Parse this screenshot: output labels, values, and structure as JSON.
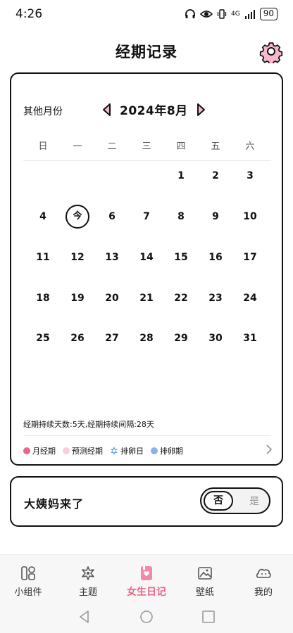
{
  "status_bar": {
    "time": "4:26",
    "network": "4G",
    "battery": "90"
  },
  "header": {
    "title": "经期记录"
  },
  "calendar": {
    "other_months_label": "其他月份",
    "month_label": "2024年8月",
    "weekdays": [
      "日",
      "一",
      "二",
      "三",
      "四",
      "五",
      "六"
    ],
    "days": [
      {
        "label": "1"
      },
      {
        "label": "2"
      },
      {
        "label": "3"
      },
      {
        "label": "4"
      },
      {
        "label": "今",
        "today": true
      },
      {
        "label": "6"
      },
      {
        "label": "7"
      },
      {
        "label": "8"
      },
      {
        "label": "9"
      },
      {
        "label": "10"
      },
      {
        "label": "11"
      },
      {
        "label": "12"
      },
      {
        "label": "13"
      },
      {
        "label": "14"
      },
      {
        "label": "15"
      },
      {
        "label": "16"
      },
      {
        "label": "17"
      },
      {
        "label": "18"
      },
      {
        "label": "19"
      },
      {
        "label": "20"
      },
      {
        "label": "21"
      },
      {
        "label": "22"
      },
      {
        "label": "23"
      },
      {
        "label": "24"
      },
      {
        "label": "25"
      },
      {
        "label": "26"
      },
      {
        "label": "27"
      },
      {
        "label": "28"
      },
      {
        "label": "29"
      },
      {
        "label": "30"
      },
      {
        "label": "31"
      }
    ],
    "first_weekday": 4,
    "stats": "经期持续天数:5天,经期持续间隔:28天",
    "legend": [
      {
        "label": "月经期",
        "color": "#e9658a",
        "icon": "dot"
      },
      {
        "label": "预测经期",
        "color": "#f8cfdc",
        "icon": "dot"
      },
      {
        "label": "排卵日",
        "color": "#6ea8e6",
        "icon": "flower"
      },
      {
        "label": "排卵期",
        "color": "#8fb0e8",
        "icon": "dot"
      }
    ]
  },
  "period_question": {
    "text": "大姨妈来了",
    "option_no": "否",
    "option_yes": "是",
    "selected": "否"
  },
  "tab_bar": {
    "tabs": [
      {
        "label": "小组件",
        "icon": "widgets-icon",
        "active": false
      },
      {
        "label": "主题",
        "icon": "theme-icon",
        "active": false
      },
      {
        "label": "女生日记",
        "icon": "diary-icon",
        "active": true
      },
      {
        "label": "壁纸",
        "icon": "wallpaper-icon",
        "active": false
      },
      {
        "label": "我的",
        "icon": "profile-icon",
        "active": false
      }
    ]
  },
  "colors": {
    "accent": "#e9658a",
    "border": "#111111",
    "pink_light": "#f8cfdc"
  }
}
